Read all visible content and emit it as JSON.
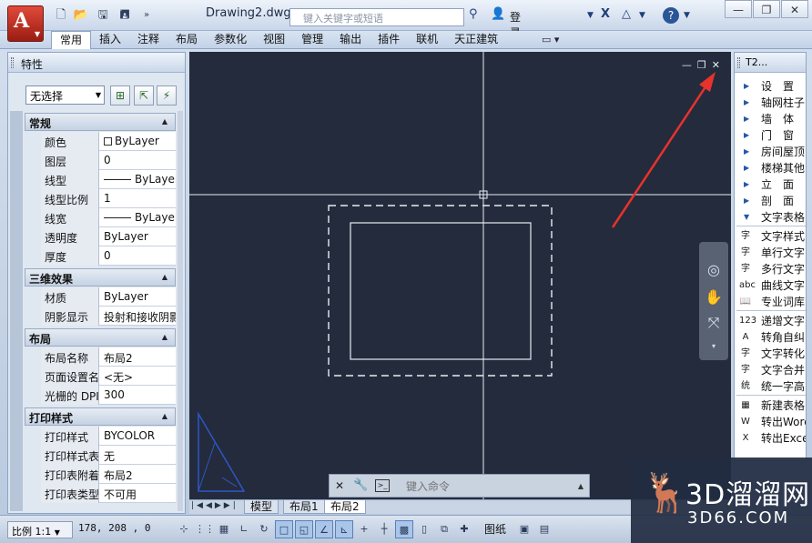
{
  "window": {
    "document_title": "Drawing2.dwg",
    "search_placeholder": "键入关键字或短语",
    "login_label": "登录",
    "help_label": "?",
    "controls": {
      "minimize": "—",
      "restore": "❐",
      "close": "✕"
    }
  },
  "ribbon": {
    "tabs": [
      "常用",
      "插入",
      "注释",
      "布局",
      "参数化",
      "视图",
      "管理",
      "输出",
      "插件",
      "联机",
      "天正建筑"
    ],
    "active_tab": 0
  },
  "properties": {
    "title": "特性",
    "selection": "无选择",
    "sections": [
      {
        "name": "常规",
        "rows": [
          {
            "key": "颜色",
            "value": "ByLayer",
            "swatch": true
          },
          {
            "key": "图层",
            "value": "0"
          },
          {
            "key": "线型",
            "value": "ByLayer",
            "line": true
          },
          {
            "key": "线型比例",
            "value": "1"
          },
          {
            "key": "线宽",
            "value": "ByLayer",
            "line": true
          },
          {
            "key": "透明度",
            "value": "ByLayer"
          },
          {
            "key": "厚度",
            "value": "0"
          }
        ]
      },
      {
        "name": "三维效果",
        "rows": [
          {
            "key": "材质",
            "value": "ByLayer"
          },
          {
            "key": "阴影显示",
            "value": "投射和接收阴影"
          }
        ]
      },
      {
        "name": "布局",
        "rows": [
          {
            "key": "布局名称",
            "value": "布局2"
          },
          {
            "key": "页面设置名",
            "value": "<无>"
          },
          {
            "key": "光栅的 DPI",
            "value": "300"
          }
        ]
      },
      {
        "name": "打印样式",
        "rows": [
          {
            "key": "打印样式",
            "value": "BYCOLOR"
          },
          {
            "key": "打印样式表",
            "value": "无"
          },
          {
            "key": "打印表附着到",
            "value": "布局2"
          },
          {
            "key": "打印表类型",
            "value": "不可用"
          }
        ]
      }
    ]
  },
  "viewport_controls": {
    "minimize": "—",
    "restore": "❐",
    "close": "✕"
  },
  "command_line": {
    "placeholder": "键入命令"
  },
  "layout_tabs": [
    "模型",
    "布局1",
    "布局2"
  ],
  "active_layout": 2,
  "tool_palette": {
    "title": "T2...",
    "groups": [
      [
        "设　置",
        "轴网柱子",
        "墙　体",
        "门　窗",
        "房间屋顶",
        "楼梯其他",
        "立　面",
        "剖　面",
        "文字表格"
      ],
      [
        "文字样式",
        "单行文字",
        "多行文字",
        "曲线文字",
        "专业词库"
      ],
      [
        "递增文字",
        "转角自纠",
        "文字转化",
        "文字合并",
        "统一字高"
      ],
      [
        "新建表格",
        "转出Word",
        "转出Excel"
      ]
    ]
  },
  "status_bar": {
    "scale": "比例 1:1",
    "coordinates": "178, 208 , 0",
    "space_label": "图纸"
  },
  "watermark": {
    "brand": "3D溜溜网",
    "domain": "3D66.COM"
  },
  "colors": {
    "canvas": "#232b3c",
    "annotation_arrow": "#e8322c"
  }
}
